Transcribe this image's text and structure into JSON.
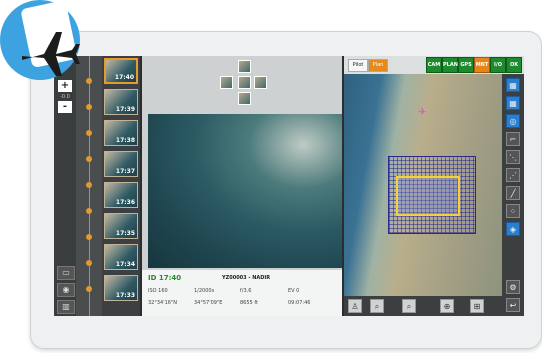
{
  "zoom": {
    "plus": "+",
    "minus": "-",
    "indicator": "-0.0"
  },
  "thumbnails": [
    {
      "label": "17:40",
      "selected": true
    },
    {
      "label": "17:39",
      "selected": false
    },
    {
      "label": "17:38",
      "selected": false
    },
    {
      "label": "17:37",
      "selected": false
    },
    {
      "label": "17:36",
      "selected": false
    },
    {
      "label": "17:35",
      "selected": false
    },
    {
      "label": "17:34",
      "selected": false
    },
    {
      "label": "17:33",
      "selected": false
    }
  ],
  "photo_info": {
    "id": "ID 17:40",
    "caption": "YZ00003 - NADIR",
    "iso": "ISO 160",
    "shutter": "1/2000s",
    "aperture": "f/3.6",
    "ev": "EV 0",
    "lat": "32°34'16\"N",
    "lon": "34°57'09\"E",
    "alt": "8655 ft",
    "time": "09:07:46"
  },
  "map_modes": [
    {
      "label": "Pilot",
      "active": false
    },
    {
      "label": "Plan",
      "active": true
    }
  ],
  "status_flags": [
    {
      "label": "CAM",
      "warn": false
    },
    {
      "label": "PLAN",
      "warn": false
    },
    {
      "label": "GPS",
      "warn": false
    },
    {
      "label": "MNT",
      "warn": true
    },
    {
      "label": "I/O",
      "warn": false
    },
    {
      "label": "OK",
      "warn": false
    }
  ],
  "colors": {
    "accent": "#e68a1e",
    "ok": "#1e8a2e",
    "badge": "#3da3e0",
    "timeline": "#c98a2b"
  },
  "icons": {
    "video": "video-icon",
    "camera": "camera-icon",
    "trash": "trash-icon",
    "plane": "plane-icon",
    "back": "back-icon"
  }
}
